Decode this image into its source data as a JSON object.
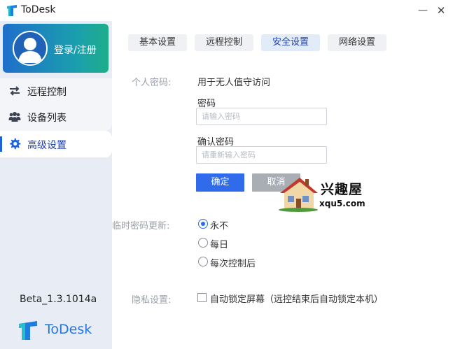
{
  "window": {
    "title": "ToDesk",
    "minimize_label": "—",
    "close_label": "✕"
  },
  "sidebar": {
    "login_label": "登录/注册",
    "items": [
      {
        "label": "远程控制",
        "icon": "swap-arrows-icon"
      },
      {
        "label": "设备列表",
        "icon": "users-icon"
      },
      {
        "label": "高级设置",
        "icon": "gear-icon",
        "active": true
      }
    ],
    "version": "Beta_1.3.1014a",
    "brand_name": "ToDesk"
  },
  "tabs": [
    {
      "label": "基本设置"
    },
    {
      "label": "远程控制"
    },
    {
      "label": "安全设置",
      "active": true
    },
    {
      "label": "网络设置"
    }
  ],
  "security": {
    "personal_password_label": "个人密码:",
    "personal_password_desc": "用于无人值守访问",
    "password_label": "密码",
    "password_placeholder": "请输入密码",
    "confirm_label": "确认密码",
    "confirm_placeholder": "请重新输入密码",
    "ok_label": "确定",
    "cancel_label": "取消",
    "temp_password_label": "临时密码更新:",
    "temp_options": [
      {
        "label": "永不",
        "checked": true
      },
      {
        "label": "每日",
        "checked": false
      },
      {
        "label": "每次控制后",
        "checked": false
      }
    ],
    "privacy_label": "隐私设置:",
    "privacy_option": "自动锁定屏幕（远控结束后自动锁定本机）"
  },
  "watermark": {
    "text": "兴趣屋",
    "url": "xqu5.com"
  },
  "colors": {
    "accent": "#2f6bea",
    "brand": "#2775db",
    "sidebar_bg": "#e8edf5"
  }
}
